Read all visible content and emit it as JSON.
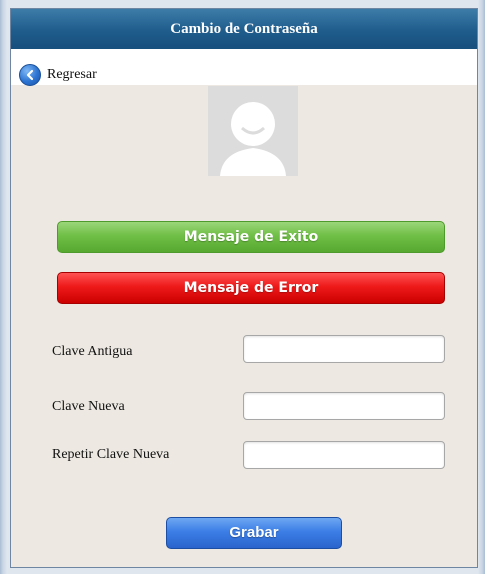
{
  "header": {
    "title": "Cambio de Contraseña"
  },
  "nav": {
    "back_label": "Regresar",
    "back_icon": "chevron-left-icon"
  },
  "profile": {
    "avatar_icon": "user-avatar-placeholder"
  },
  "messages": {
    "success": "Mensaje de Exito",
    "error": "Mensaje de Error"
  },
  "form": {
    "old_password_label": "Clave Antigua",
    "old_password_value": "",
    "new_password_label": "Clave Nueva",
    "new_password_value": "",
    "repeat_password_label": "Repetir Clave Nueva",
    "repeat_password_value": "",
    "save_label": "Grabar"
  },
  "colors": {
    "header": "#1f5c8c",
    "panel_background": "#ede9e2",
    "success": "#70bf47",
    "error": "#ee1a1a",
    "primary_button": "#3b7ee6"
  }
}
